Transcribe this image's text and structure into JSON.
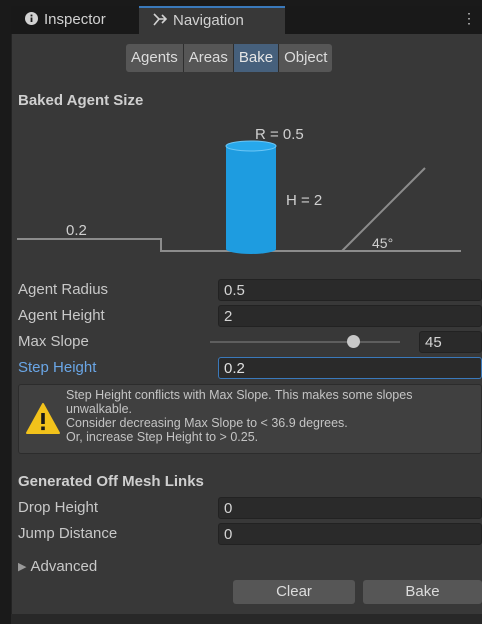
{
  "tabs": {
    "inspector": "Inspector",
    "navigation": "Navigation"
  },
  "segmented": [
    "Agents",
    "Areas",
    "Bake",
    "Object"
  ],
  "segmented_active": "Bake",
  "baked_agent": {
    "title": "Baked Agent Size",
    "radius_label": "R = 0.5",
    "height_label": "H = 2",
    "step_label": "0.2",
    "slope_label": "45°"
  },
  "fields": {
    "agent_radius": {
      "label": "Agent Radius",
      "value": "0.5"
    },
    "agent_height": {
      "label": "Agent Height",
      "value": "2"
    },
    "max_slope": {
      "label": "Max Slope",
      "value": "45"
    },
    "step_height": {
      "label": "Step Height",
      "value": "0.2"
    }
  },
  "slider_fraction": 0.75,
  "warning": {
    "line1": "Step Height conflicts with Max Slope. This makes some slopes",
    "line2": "unwalkable.",
    "line3": "Consider decreasing Max Slope to < 36.9 degrees.",
    "line4": "Or, increase Step Height to > 0.25."
  },
  "offmesh": {
    "title": "Generated Off Mesh Links",
    "drop_height": {
      "label": "Drop Height",
      "value": "0"
    },
    "jump_distance": {
      "label": "Jump Distance",
      "value": "0"
    }
  },
  "advanced_label": "Advanced",
  "buttons": {
    "clear": "Clear",
    "bake": "Bake"
  },
  "colors": {
    "accent": "#3a79bb",
    "cylinder": "#1e9ce0",
    "warning": "#f2c21b"
  }
}
